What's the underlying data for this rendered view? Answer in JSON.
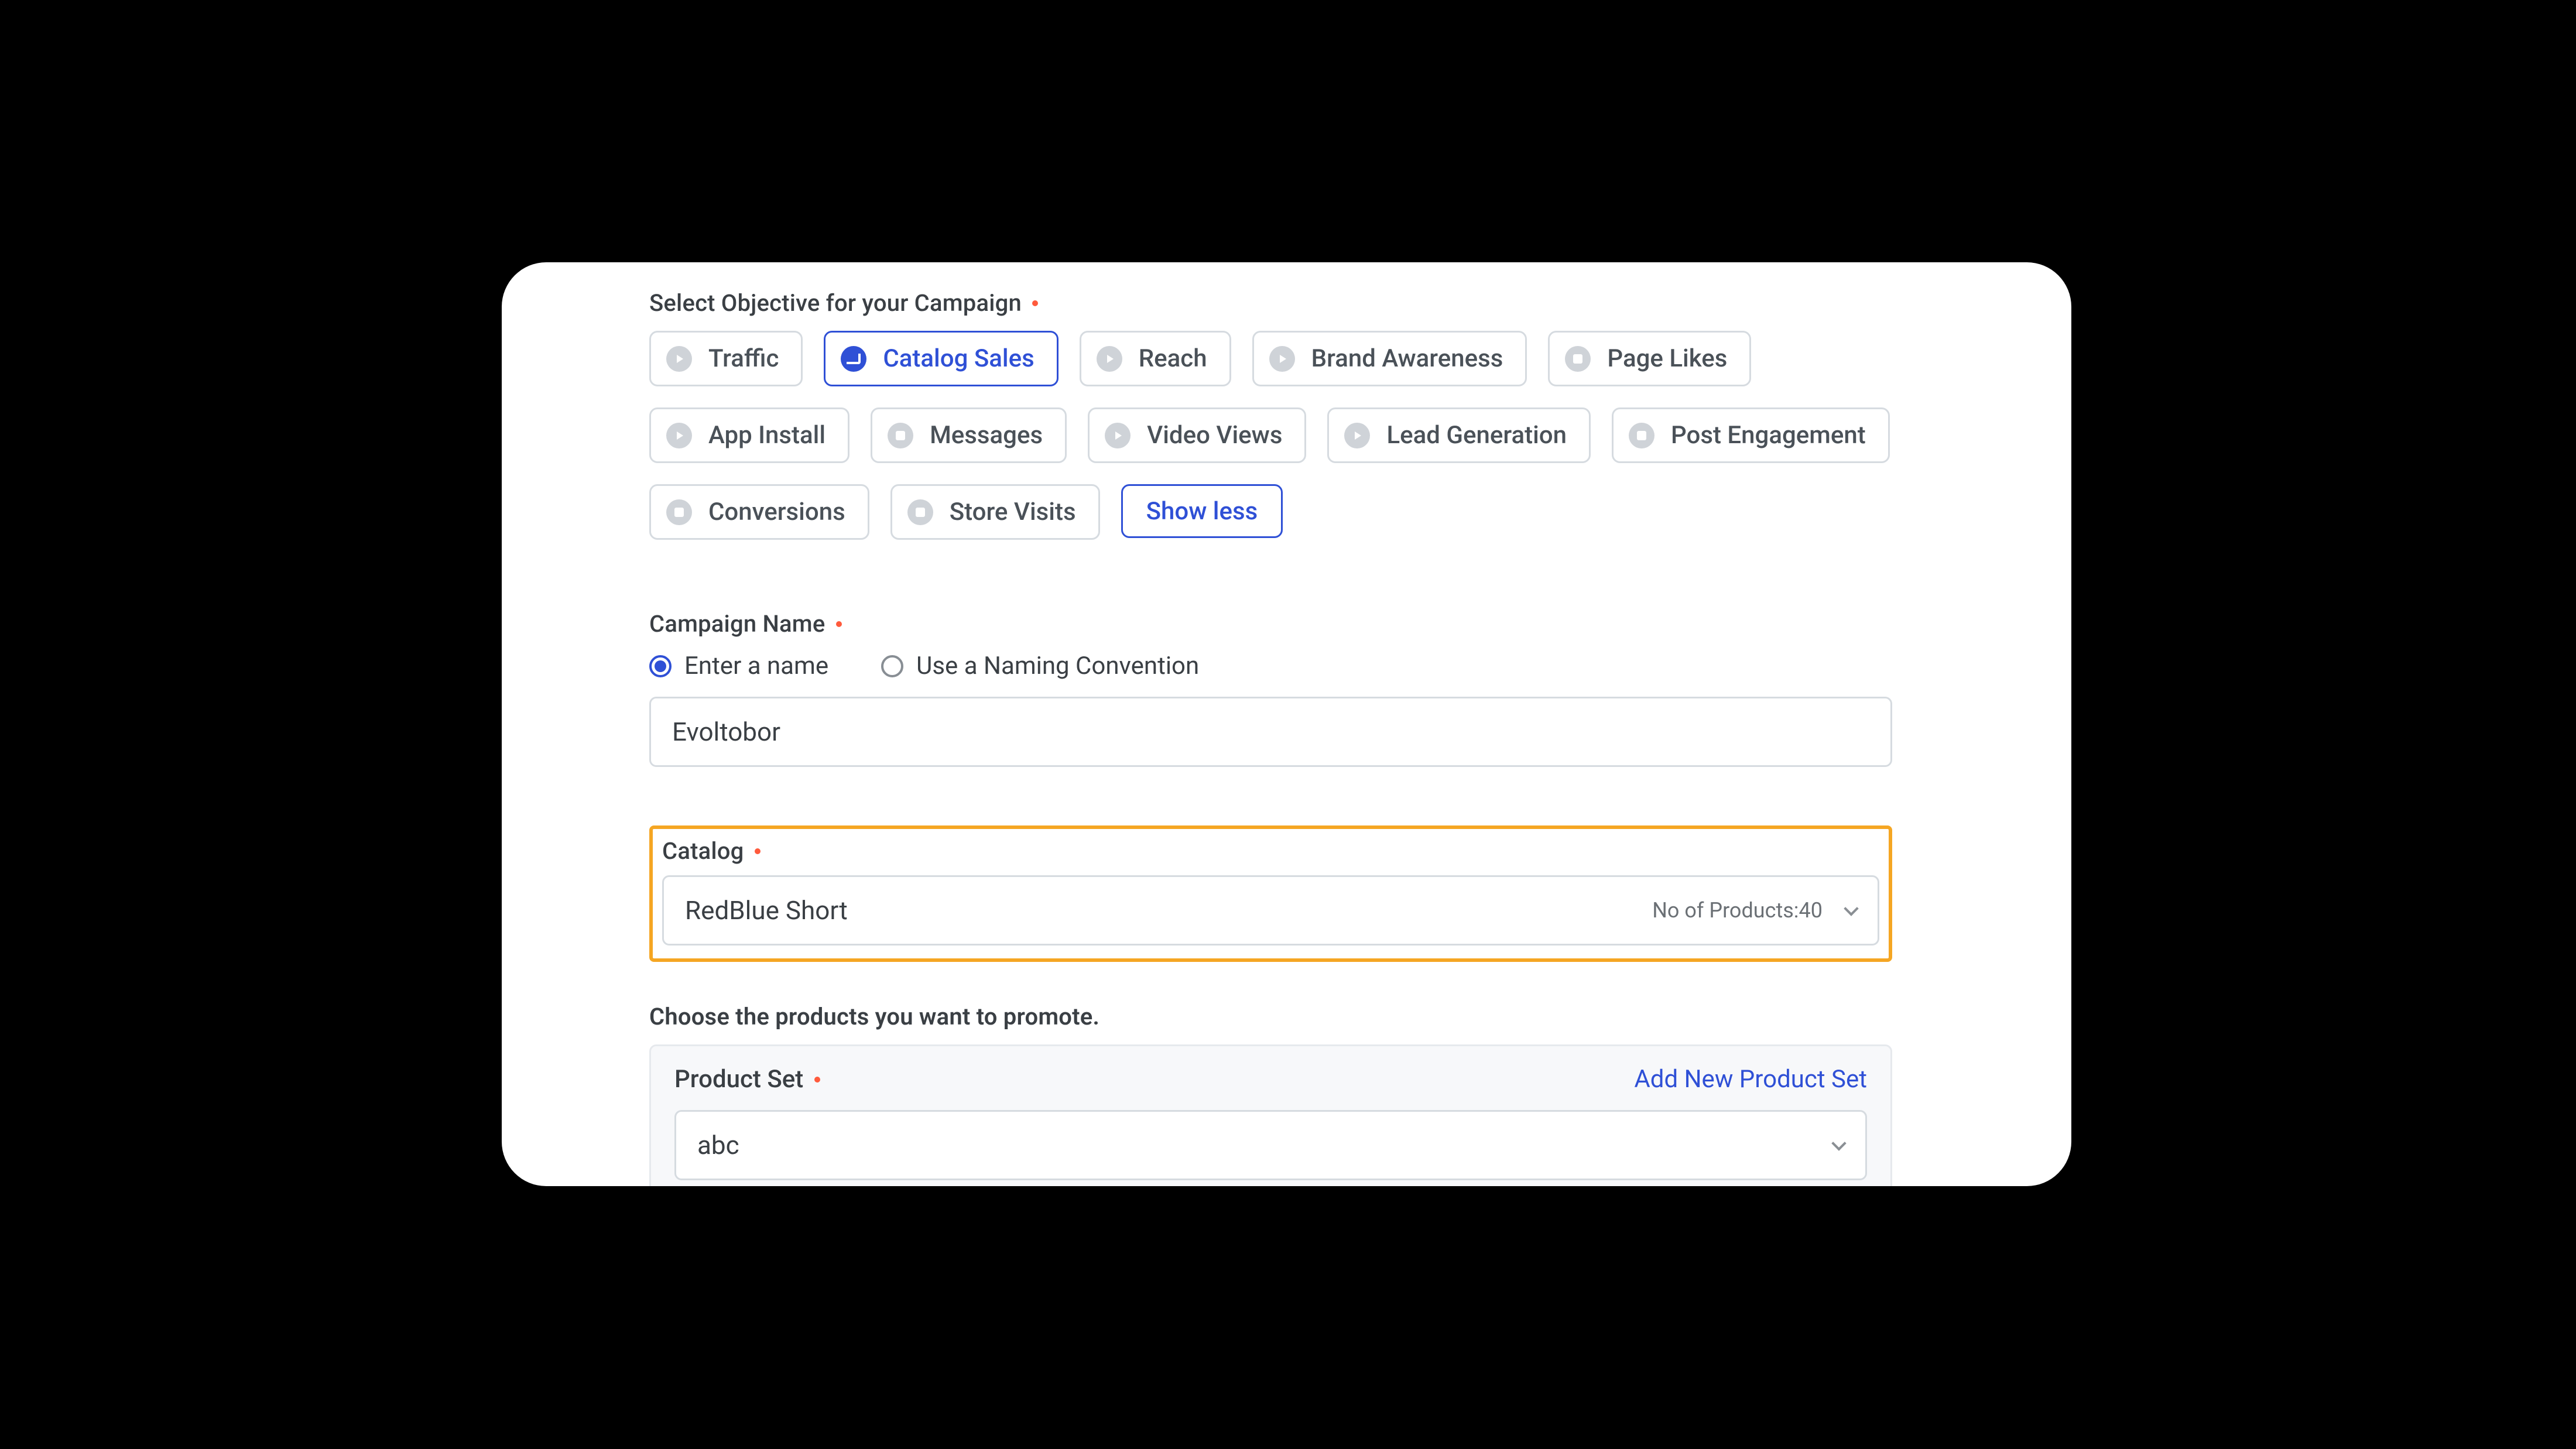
{
  "labels": {
    "objective": "Select Objective for your Campaign",
    "campaign_name": "Campaign Name",
    "catalog": "Catalog",
    "choose_products": "Choose the products you want to promote.",
    "product_set": "Product Set",
    "show_less": "Show less",
    "add_new_product_set": "Add New Product Set"
  },
  "objectives": [
    {
      "id": "traffic",
      "label": "Traffic",
      "selected": false,
      "icon": "play"
    },
    {
      "id": "catalog-sales",
      "label": "Catalog Sales",
      "selected": true,
      "icon": "cart"
    },
    {
      "id": "reach",
      "label": "Reach",
      "selected": false,
      "icon": "play"
    },
    {
      "id": "brand-awareness",
      "label": "Brand Awareness",
      "selected": false,
      "icon": "play"
    },
    {
      "id": "page-likes",
      "label": "Page Likes",
      "selected": false,
      "icon": "like"
    },
    {
      "id": "app-install",
      "label": "App Install",
      "selected": false,
      "icon": "play"
    },
    {
      "id": "messages",
      "label": "Messages",
      "selected": false,
      "icon": "chat"
    },
    {
      "id": "video-views",
      "label": "Video Views",
      "selected": false,
      "icon": "play"
    },
    {
      "id": "lead-generation",
      "label": "Lead Generation",
      "selected": false,
      "icon": "play"
    },
    {
      "id": "post-engagement",
      "label": "Post Engagement",
      "selected": false,
      "icon": "like"
    },
    {
      "id": "conversions",
      "label": "Conversions",
      "selected": false,
      "icon": "conv"
    },
    {
      "id": "store-visits",
      "label": "Store Visits",
      "selected": false,
      "icon": "store"
    }
  ],
  "campaign_name": {
    "mode_options": [
      {
        "id": "enter",
        "label": "Enter a name",
        "selected": true
      },
      {
        "id": "convention",
        "label": "Use a Naming Convention",
        "selected": false
      }
    ],
    "value": "Evoltobor"
  },
  "catalog": {
    "selected": "RedBlue Short",
    "products_label": "No of Products:",
    "products_count": 40
  },
  "product_set": {
    "selected": "abc"
  }
}
